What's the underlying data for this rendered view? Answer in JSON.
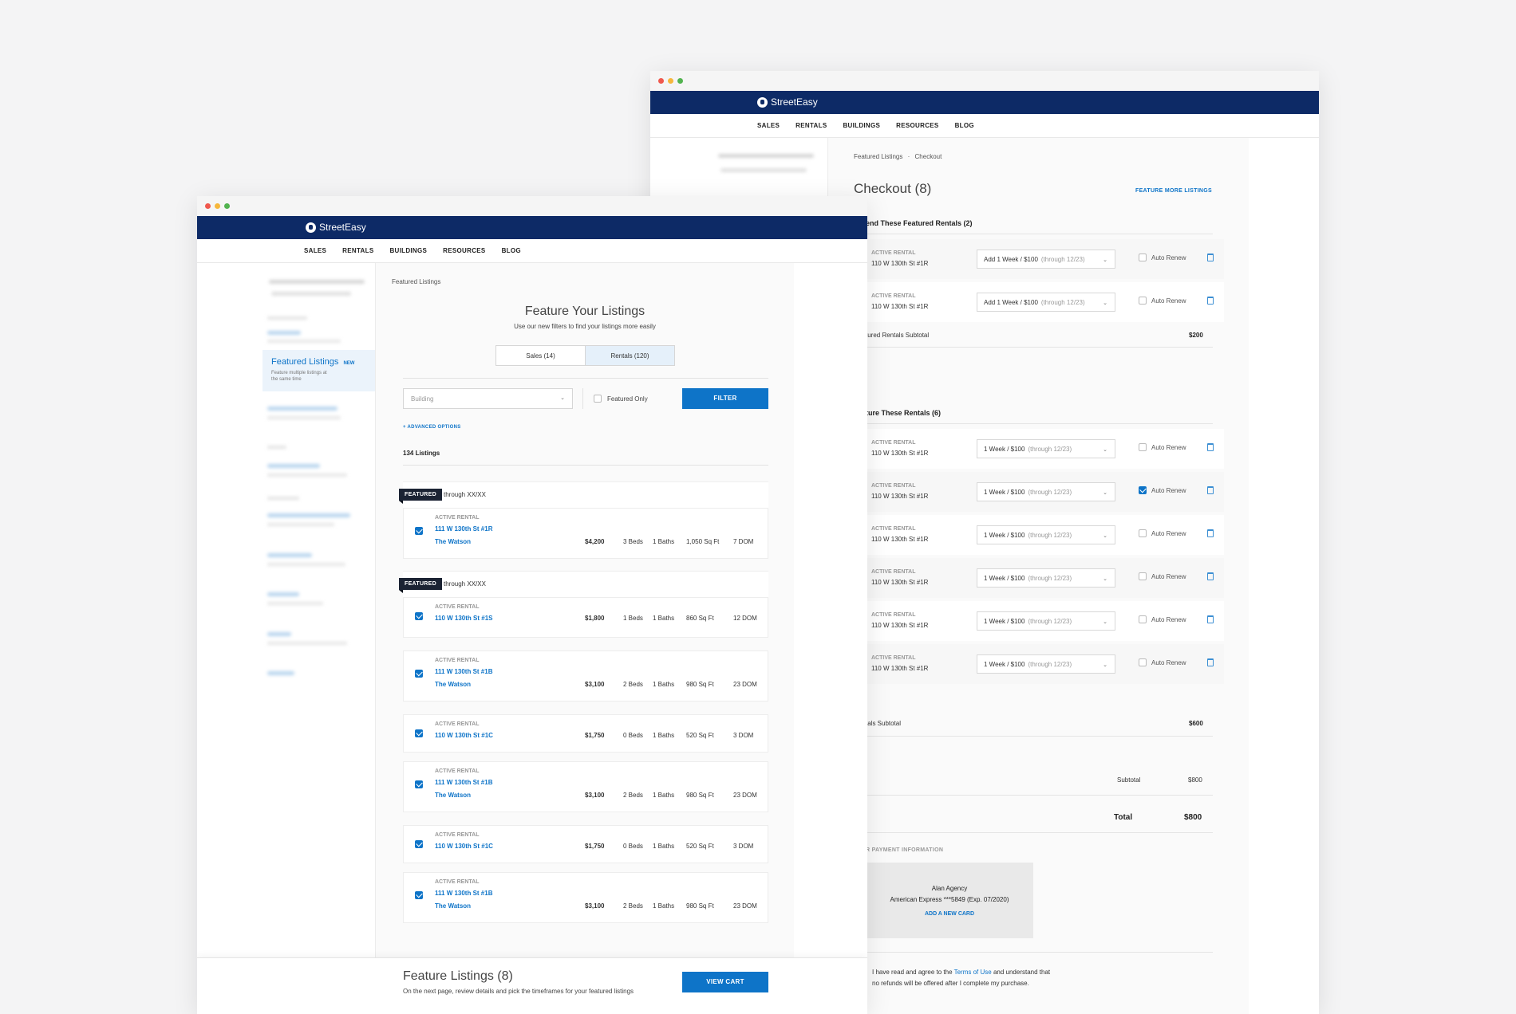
{
  "brand": "StreetEasy",
  "nav": [
    "SALES",
    "RENTALS",
    "BUILDINGS",
    "RESOURCES",
    "BLOG"
  ],
  "checkout": {
    "breadcrumb": [
      "Featured Listings",
      "Checkout"
    ],
    "title": "Checkout (8)",
    "feature_more": "FEATURE MORE LISTINGS",
    "section1_title": "end These Featured Rentals (2)",
    "section1_rows": [
      {
        "status": "ACTIVE RENTAL",
        "addr": "110 W 130th St #1R",
        "select": "Add 1 Week / $100",
        "select_note": "(through 12/23)",
        "auto": "Auto Renew",
        "checked": false
      },
      {
        "status": "ACTIVE RENTAL",
        "addr": "110 W 130th St #1R",
        "select": "Add 1 Week / $100",
        "select_note": "(through 12/23)",
        "auto": "Auto Renew",
        "checked": false
      }
    ],
    "section1_subtotal_label": "tured Rentals Subtotal",
    "section1_subtotal": "$200",
    "section2_title": "ture These Rentals (6)",
    "section2_rows": [
      {
        "status": "ACTIVE RENTAL",
        "addr": "110 W 130th St #1R",
        "select": "1 Week / $100",
        "select_note": "(through 12/23)",
        "auto": "Auto Renew",
        "checked": false
      },
      {
        "status": "ACTIVE RENTAL",
        "addr": "110 W 130th St #1R",
        "select": "1 Week / $100",
        "select_note": "(through 12/23)",
        "auto": "Auto Renew",
        "checked": true
      },
      {
        "status": "ACTIVE RENTAL",
        "addr": "110 W 130th St #1R",
        "select": "1 Week / $100",
        "select_note": "(through 12/23)",
        "auto": "Auto Renew",
        "checked": false
      },
      {
        "status": "ACTIVE RENTAL",
        "addr": "110 W 130th St #1R",
        "select": "1 Week / $100",
        "select_note": "(through 12/23)",
        "auto": "Auto Renew",
        "checked": false
      },
      {
        "status": "ACTIVE RENTAL",
        "addr": "110 W 130th St #1R",
        "select": "1 Week / $100",
        "select_note": "(through 12/23)",
        "auto": "Auto Renew",
        "checked": false
      },
      {
        "status": "ACTIVE RENTAL",
        "addr": "110 W 130th St #1R",
        "select": "1 Week / $100",
        "select_note": "(through 12/23)",
        "auto": "Auto Renew",
        "checked": false
      }
    ],
    "section2_subtotal_label": "tals Subtotal",
    "section2_subtotal": "$600",
    "subtotal_label": "Subtotal",
    "subtotal": "$800",
    "total_label": "Total",
    "total": "$800",
    "payment_label": "R PAYMENT INFORMATION",
    "payment_name": "Alan Agency",
    "payment_card": "American Express ***5849 (Exp. 07/2020)",
    "add_card": "ADD A NEW CARD",
    "terms_pre": "I have read and agree to the ",
    "terms_link": "Terms of Use",
    "terms_post": " and understand that",
    "terms_line2": "no refunds will be offered after I complete my purchase."
  },
  "feature": {
    "breadcrumb": "Featured Listings",
    "sidebar_active": "Featured Listings",
    "sidebar_badge": "NEW",
    "sidebar_desc_1": "Feature multiple listings at",
    "sidebar_desc_2": "the same time",
    "title": "Feature Your Listings",
    "subtitle": "Use our new filters to find your listings more easily",
    "tabs": [
      {
        "label": "Sales (14)",
        "active": false
      },
      {
        "label": "Rentals (120)",
        "active": true
      }
    ],
    "building_placeholder": "Building",
    "featured_only": "Featured Only",
    "filter_btn": "FILTER",
    "advanced": "+ ADVANCED OPTIONS",
    "count": "134 Listings",
    "featured_ribbon": "FEATURED",
    "through": "through XX/XX",
    "listings": [
      {
        "status": "ACTIVE RENTAL",
        "addr": "111 W 130th St #1R",
        "bld": "The Watson",
        "price": "$4,200",
        "beds": "3 Beds",
        "baths": "1 Baths",
        "sqft": "1,050 Sq Ft",
        "dom": "7 DOM",
        "checked": true
      },
      {
        "status": "ACTIVE RENTAL",
        "addr": "110 W 130th St #1S",
        "bld": "",
        "price": "$1,800",
        "beds": "1 Beds",
        "baths": "1 Baths",
        "sqft": "860 Sq Ft",
        "dom": "12 DOM",
        "checked": true
      },
      {
        "status": "ACTIVE RENTAL",
        "addr": "111 W 130th St #1B",
        "bld": "The Watson",
        "price": "$3,100",
        "beds": "2 Beds",
        "baths": "1 Baths",
        "sqft": "980 Sq Ft",
        "dom": "23 DOM",
        "checked": true
      },
      {
        "status": "ACTIVE RENTAL",
        "addr": "110 W 130th St #1C",
        "bld": "",
        "price": "$1,750",
        "beds": "0 Beds",
        "baths": "1 Baths",
        "sqft": "520 Sq Ft",
        "dom": "3 DOM",
        "checked": true
      },
      {
        "status": "ACTIVE RENTAL",
        "addr": "111 W 130th St #1B",
        "bld": "The Watson",
        "price": "$3,100",
        "beds": "2 Beds",
        "baths": "1 Baths",
        "sqft": "980 Sq Ft",
        "dom": "23 DOM",
        "checked": true
      },
      {
        "status": "ACTIVE RENTAL",
        "addr": "110 W 130th St #1C",
        "bld": "",
        "price": "$1,750",
        "beds": "0 Beds",
        "baths": "1 Baths",
        "sqft": "520 Sq Ft",
        "dom": "3 DOM",
        "checked": true
      },
      {
        "status": "ACTIVE RENTAL",
        "addr": "111 W 130th St #1B",
        "bld": "The Watson",
        "price": "$3,100",
        "beds": "2 Beds",
        "baths": "1 Baths",
        "sqft": "980 Sq Ft",
        "dom": "23 DOM",
        "checked": true
      }
    ],
    "footer_title": "Feature Listings (8)",
    "footer_sub": "On the next page, review details and pick the timeframes for your featured listings",
    "view_cart": "VIEW CART"
  },
  "colors": {
    "brand_navy": "#0d2a66",
    "accent_blue": "#0e74c8"
  }
}
